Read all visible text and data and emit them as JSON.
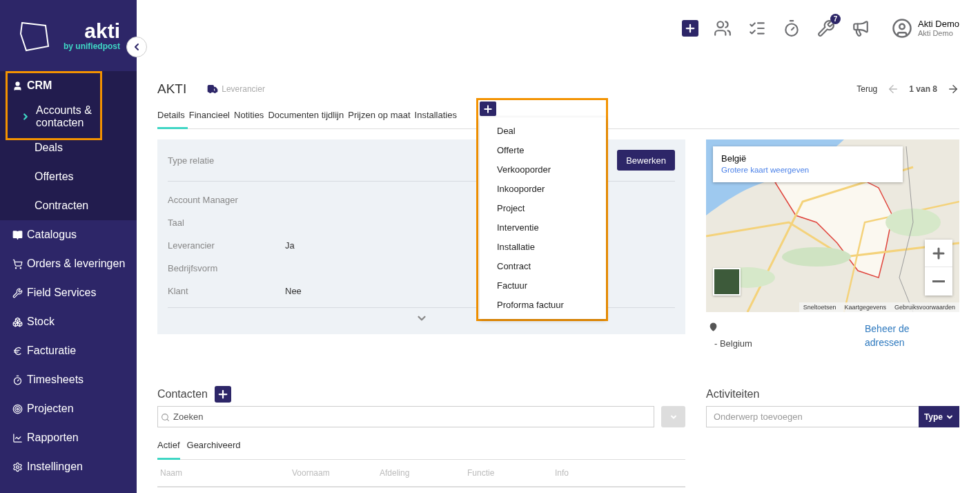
{
  "sidebar": {
    "logo": {
      "name": "akti",
      "tagline": "by unifiedpost"
    },
    "items": [
      {
        "label": "CRM",
        "expanded": true,
        "highlighted": true,
        "children": [
          {
            "label": "Accounts & contacten",
            "selected": true
          },
          {
            "label": "Deals",
            "selected": false
          },
          {
            "label": "Offertes",
            "selected": false
          },
          {
            "label": "Contracten",
            "selected": false
          }
        ]
      },
      {
        "label": "Catalogus",
        "expanded": false
      },
      {
        "label": "Orders & leveringen",
        "expanded": false
      },
      {
        "label": "Field Services",
        "expanded": false
      },
      {
        "label": "Stock",
        "expanded": false
      },
      {
        "label": "Facturatie",
        "expanded": false
      },
      {
        "label": "Timesheets",
        "expanded": false
      },
      {
        "label": "Projecten",
        "expanded": false
      },
      {
        "label": "Rapporten",
        "expanded": false
      },
      {
        "label": "Instellingen",
        "expanded": false
      }
    ]
  },
  "header": {
    "notifications": "7",
    "user": {
      "name": "Akti Demo",
      "company": "Akti Demo"
    }
  },
  "account": {
    "name": "AKTI",
    "type": "Leverancier",
    "back": "Terug",
    "pager": "1 van 8"
  },
  "tabs": [
    {
      "label": "Details",
      "selected": true
    },
    {
      "label": "Financieel",
      "selected": false
    },
    {
      "label": "Notities",
      "selected": false
    },
    {
      "label": "Documenten tijdlijn",
      "selected": false
    },
    {
      "label": "Prijzen op maat",
      "selected": false
    },
    {
      "label": "Installaties",
      "selected": false
    }
  ],
  "add_menu": {
    "highlighted": true,
    "items": [
      "Deal",
      "Offerte",
      "Verkooporder",
      "Inkooporder",
      "Project",
      "Interventie",
      "Installatie",
      "Contract",
      "Factuur",
      "Proforma factuur"
    ]
  },
  "details": {
    "type_label": "Type relatie",
    "edit_button": "Bewerken",
    "fields": [
      {
        "label": "Account Manager"
      },
      {
        "label": "Taal"
      },
      {
        "label": "Leverancier",
        "value": "Ja"
      },
      {
        "label": "Bedrijfsvorm"
      },
      {
        "label": "Klant",
        "value": "Nee"
      }
    ]
  },
  "map": {
    "kind": "picture",
    "card_title": "België",
    "card_link": "Grotere kaart weergeven",
    "footer_links": [
      "Sneltoetsen",
      "Kaartgegevens",
      "Gebruiksvoorwaarden"
    ]
  },
  "address": {
    "line": "- Belgium",
    "manage_link": "Beheer de adressen"
  },
  "contacts": {
    "title": "Contacten",
    "search_placeholder": "Zoeken",
    "tabs": [
      {
        "label": "Actief",
        "selected": true
      },
      {
        "label": "Gearchiveerd",
        "selected": false
      }
    ],
    "columns": [
      "Naam",
      "Voornaam",
      "Afdeling",
      "Functie",
      "Info"
    ]
  },
  "activities": {
    "title": "Activiteiten",
    "placeholder": "Onderwerp toevoegen",
    "type_button": "Type"
  }
}
